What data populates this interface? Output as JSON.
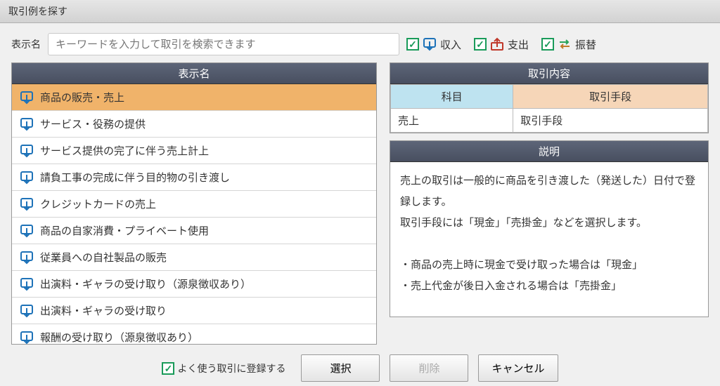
{
  "title": "取引例を探す",
  "search": {
    "label": "表示名",
    "placeholder": "キーワードを入力して取引を検索できます"
  },
  "types": {
    "income": "収入",
    "expense": "支出",
    "transfer": "振替"
  },
  "list": {
    "header": "表示名",
    "items": [
      {
        "label": "商品の販売・売上",
        "selected": true
      },
      {
        "label": "サービス・役務の提供"
      },
      {
        "label": "サービス提供の完了に伴う売上計上"
      },
      {
        "label": "請負工事の完成に伴う目的物の引き渡し"
      },
      {
        "label": "クレジットカードの売上"
      },
      {
        "label": "商品の自家消費・プライベート使用"
      },
      {
        "label": "従業員への自社製品の販売"
      },
      {
        "label": "出演料・ギャラの受け取り（源泉徴収あり）"
      },
      {
        "label": "出演料・ギャラの受け取り"
      },
      {
        "label": "報酬の受け取り（源泉徴収あり）"
      }
    ]
  },
  "detail": {
    "header": "取引内容",
    "subject_header": "科目",
    "method_header": "取引手段",
    "subject_value": "売上",
    "method_value": "取引手段"
  },
  "description": {
    "header": "説明",
    "body_line1": "売上の取引は一般的に商品を引き渡した（発送した）日付で登録します。",
    "body_line2": "取引手段には「現金」「売掛金」などを選択します。",
    "bullet1": "・商品の売上時に現金で受け取った場合は「現金」",
    "bullet2": "・売上代金が後日入金される場合は「売掛金」"
  },
  "footer": {
    "favorite": "よく使う取引に登録する",
    "select": "選択",
    "delete": "削除",
    "cancel": "キャンセル"
  }
}
